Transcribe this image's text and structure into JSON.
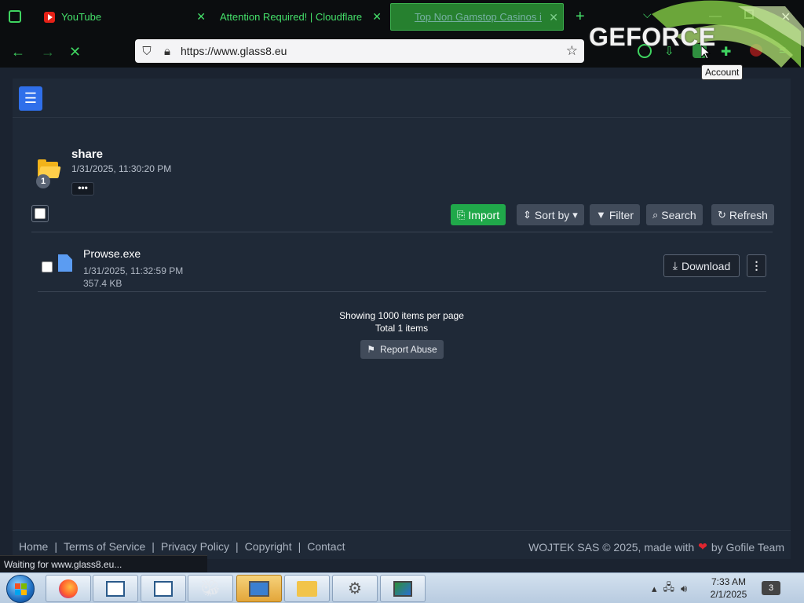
{
  "browser": {
    "tabs": [
      {
        "title": "YouTube",
        "favicon": "youtube-icon",
        "active": false
      },
      {
        "title": "Attention Required! | Cloudflare",
        "favicon": "",
        "active": false
      },
      {
        "title": "Top Non Gamstop Casinos in t",
        "favicon": "",
        "active": true
      }
    ],
    "new_tab_label": "+",
    "url": "https://www.glass8.eu",
    "tooltip": "Account",
    "overlay_brand": "GEFORCE",
    "status_text": "Waiting for www.glass8.eu..."
  },
  "app": {
    "folder": {
      "name": "share",
      "date": "1/31/2025, 11:30:20 PM",
      "count": "1",
      "menu_label": "•••"
    },
    "toolbar": {
      "import_label": "Import",
      "sort_label": "Sort by",
      "filter_label": "Filter",
      "search_label": "Search",
      "refresh_label": "Refresh"
    },
    "files": [
      {
        "name": "Prowse.exe",
        "date": "1/31/2025, 11:32:59 PM",
        "size": "357.4 KB",
        "download_label": "Download"
      }
    ],
    "paging": {
      "per_page_text": "Showing 1000 items per page",
      "total_text": "Total 1 items"
    },
    "report_label": "Report Abuse",
    "footer": {
      "links": [
        "Home",
        "Terms of Service",
        "Privacy Policy",
        "Copyright",
        "Contact"
      ],
      "copyright": "WOJTEK SAS © 2025, made with",
      "by": "by Gofile Team"
    }
  },
  "taskbar": {
    "time": "7:33 AM",
    "date": "2/1/2025",
    "notification_count": "3"
  },
  "colors": {
    "accent_green": "#20a84a",
    "menu_blue": "#2f6fea",
    "page_bg": "#1f2937",
    "tab_green": "#45e06a"
  }
}
